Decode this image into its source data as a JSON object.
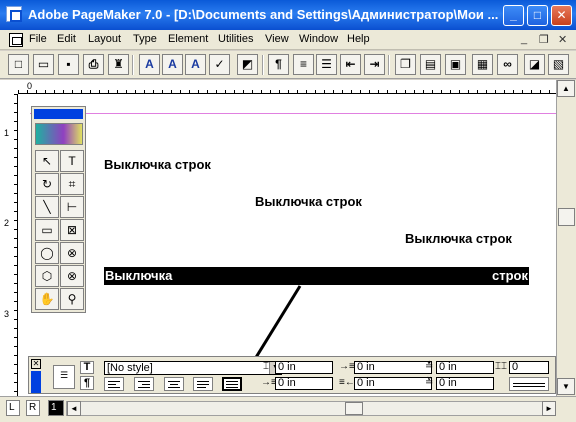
{
  "window": {
    "title": "Adobe PageMaker 7.0 - [D:\\Documents and Settings\\Администратор\\Мои ...",
    "minimize": "_",
    "maximize": "□",
    "close": "✕"
  },
  "menu": {
    "items": [
      "File",
      "Edit",
      "Layout",
      "Type",
      "Element",
      "Utilities",
      "View",
      "Window",
      "Help"
    ],
    "mdi_min": "_",
    "mdi_restore": "❐",
    "mdi_close": "✕"
  },
  "toolbar": {
    "buttons": [
      {
        "name": "new-icon",
        "glyph": "□"
      },
      {
        "name": "open-icon",
        "glyph": "▭"
      },
      {
        "name": "save-icon",
        "glyph": "▪"
      },
      {
        "name": "print-icon",
        "glyph": "⎙"
      },
      {
        "name": "find-icon",
        "glyph": "♜"
      },
      {
        "name": "font-icon",
        "glyph": "A"
      },
      {
        "name": "font-grow-icon",
        "glyph": "A"
      },
      {
        "name": "font-shrink-icon",
        "glyph": "A"
      },
      {
        "name": "spellcheck-icon",
        "glyph": "✓"
      },
      {
        "name": "fill-icon",
        "glyph": "◩"
      },
      {
        "name": "paragraph-icon",
        "glyph": "¶"
      },
      {
        "name": "indent-icon",
        "glyph": "≡"
      },
      {
        "name": "bullets-icon",
        "glyph": "☰"
      },
      {
        "name": "outdent-icon",
        "glyph": "⇤"
      },
      {
        "name": "indent-right-icon",
        "glyph": "⇥"
      },
      {
        "name": "copy-icon",
        "glyph": "❐"
      },
      {
        "name": "paste-icon",
        "glyph": "▤"
      },
      {
        "name": "frame-icon",
        "glyph": "▣"
      },
      {
        "name": "image-icon",
        "glyph": "▦"
      },
      {
        "name": "link-icon",
        "glyph": "∞"
      },
      {
        "name": "picture-icon",
        "glyph": "◪"
      },
      {
        "name": "color-icon",
        "glyph": "▧"
      }
    ]
  },
  "ruler": {
    "h": [
      "0"
    ],
    "v": [
      "1",
      "2",
      "3"
    ]
  },
  "document": {
    "line_left": "Выключка строк",
    "line_center": "Выключка строк",
    "line_right": "Выключка строк",
    "line_justified_a": "Выключка",
    "line_justified_b": "строк"
  },
  "toolbox": {
    "tools": [
      {
        "name": "pointer-tool-icon",
        "glyph": "↖"
      },
      {
        "name": "text-tool-icon",
        "glyph": "T"
      },
      {
        "name": "rotate-tool-icon",
        "glyph": "↻"
      },
      {
        "name": "crop-tool-icon",
        "glyph": "⌗"
      },
      {
        "name": "line-tool-icon",
        "glyph": "╲"
      },
      {
        "name": "constrained-line-tool-icon",
        "glyph": "⊢"
      },
      {
        "name": "rectangle-tool-icon",
        "glyph": "▭"
      },
      {
        "name": "rectangle-frame-tool-icon",
        "glyph": "⊠"
      },
      {
        "name": "ellipse-tool-icon",
        "glyph": "◯"
      },
      {
        "name": "ellipse-frame-tool-icon",
        "glyph": "⊗"
      },
      {
        "name": "polygon-tool-icon",
        "glyph": "⬡"
      },
      {
        "name": "polygon-frame-tool-icon",
        "glyph": "⊗"
      },
      {
        "name": "hand-tool-icon",
        "glyph": "✋"
      },
      {
        "name": "zoom-tool-icon",
        "glyph": "⚲"
      }
    ]
  },
  "control_palette": {
    "close": "✕",
    "char_mode": "T",
    "para_mode": "¶",
    "style_value": "[No style]",
    "style_arrow": "▼",
    "left_indent": "0 in",
    "first_indent": "0 in",
    "right_indent": "0 in",
    "space_after_right": "0 in",
    "space_before": "0 in",
    "space_after": "0 in",
    "grid": "0"
  },
  "bottom": {
    "left_tab": "L",
    "right_tab": "R",
    "page_tab": "1",
    "scroll_left": "◄",
    "scroll_right": "►"
  },
  "scroll": {
    "up": "▲",
    "down": "▼"
  }
}
